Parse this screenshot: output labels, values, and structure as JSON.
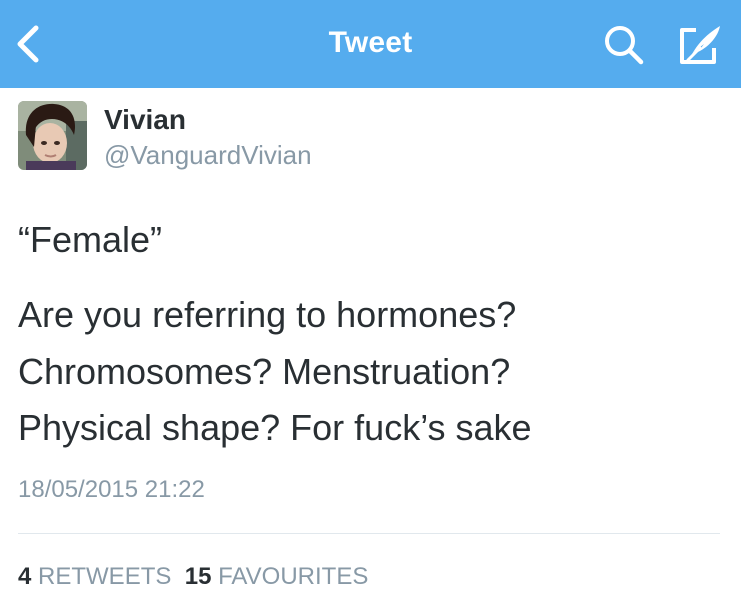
{
  "nav": {
    "title": "Tweet"
  },
  "user": {
    "name": "Vivian",
    "handle": "@VanguardVivian"
  },
  "tweet": {
    "lines": [
      "“Female”",
      "Are you referring to hormones?",
      "Chromosomes? Menstruation?",
      "Physical shape? For fuck’s sake"
    ],
    "timestamp": "18/05/2015 21:22"
  },
  "stats": {
    "retweets_count": "4",
    "retweets_label": "RETWEETS",
    "favourites_count": "15",
    "favourites_label": "FAVOURITES"
  },
  "colors": {
    "navbar": "#55acee",
    "text": "#292f33",
    "secondary": "#8899a6"
  },
  "icons": {
    "back": "chevron-left-icon",
    "search": "search-icon",
    "compose": "compose-icon"
  }
}
